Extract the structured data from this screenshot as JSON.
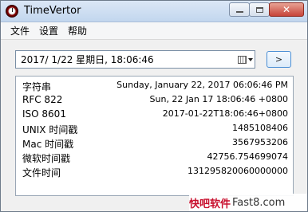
{
  "window": {
    "title": "TimeVertor"
  },
  "menu": [
    {
      "label": "文件"
    },
    {
      "label": "设置"
    },
    {
      "label": "帮助"
    }
  ],
  "date_input": {
    "value": "2017/  1/22 星期日, 18:06:46"
  },
  "go_button": {
    "label": ">"
  },
  "results": [
    {
      "label": "字符串",
      "value": "Sunday, January 22, 2017 06:06:46 PM"
    },
    {
      "label": "RFC 822",
      "value": "Sun, 22 Jan 17 18:06:46 +0800"
    },
    {
      "label": "ISO 8601",
      "value": "2017-01-22T18:06:46+0800"
    },
    {
      "label": "UNIX 时间戳",
      "value": "1485108406"
    },
    {
      "label": "Mac 时间戳",
      "value": "3567953206"
    },
    {
      "label": "微软时间戳",
      "value": "42756.754699074"
    },
    {
      "label": "文件时间",
      "value": "131295820060000000"
    }
  ],
  "watermark": {
    "brand": "快吧软件",
    "site": "Fast8.com"
  }
}
